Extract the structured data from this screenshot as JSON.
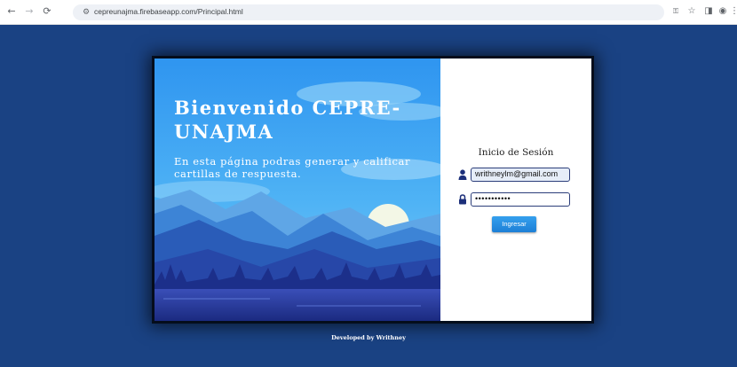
{
  "browser": {
    "url": "cepreunajma.firebaseapp.com/Principal.html",
    "icons": [
      "back-icon",
      "forward-icon",
      "reload-icon",
      "site-info-icon",
      "password-key-icon",
      "bookmark-star-icon",
      "side-panel-icon",
      "extension-icon",
      "menu-icon"
    ]
  },
  "hero": {
    "title": "Bienvenido CEPRE-UNAJMA",
    "subtitle": "En esta página podras generar y calificar cartillas de respuesta."
  },
  "login": {
    "title": "Inicio de Sesión",
    "email_value": "writhneylm@gmail.com",
    "password_value": "•••••••••••",
    "submit_label": "Ingresar"
  },
  "footer": {
    "text": "Developed by Writhney"
  },
  "colors": {
    "page_bg": "#1a4283",
    "button": "#1d7fd6",
    "field_border": "#2c3e7a"
  }
}
